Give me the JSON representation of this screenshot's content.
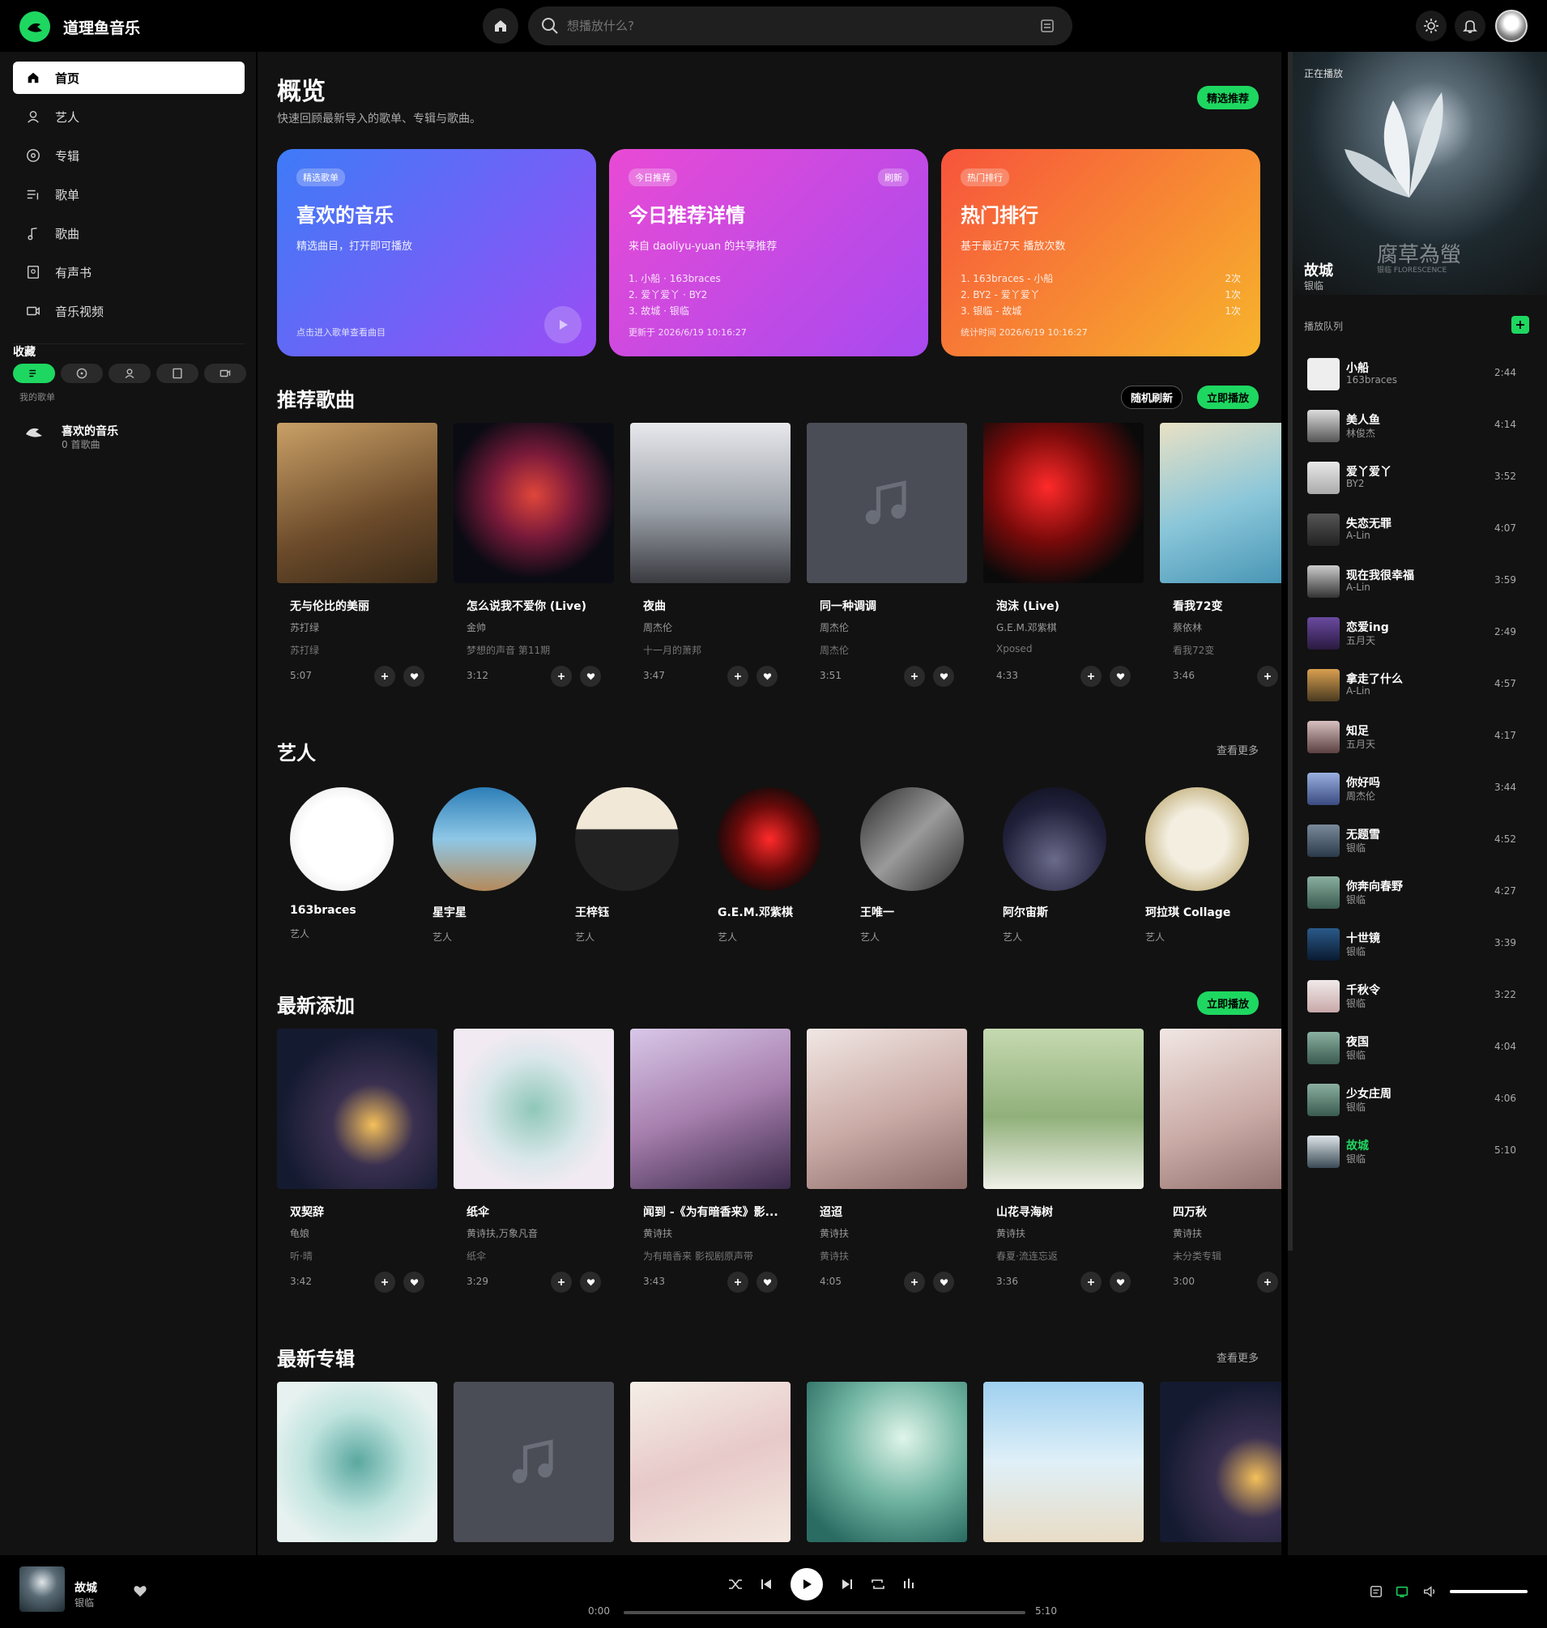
{
  "app": {
    "name": "道理鱼音乐"
  },
  "search": {
    "placeholder": "想播放什么?"
  },
  "sidebar": {
    "items": [
      {
        "label": "首页",
        "icon": "home-icon"
      },
      {
        "label": "艺人",
        "icon": "user-icon"
      },
      {
        "label": "专辑",
        "icon": "disc-icon"
      },
      {
        "label": "歌单",
        "icon": "playlist-icon"
      },
      {
        "label": "歌曲",
        "icon": "music-note-icon"
      },
      {
        "label": "有声书",
        "icon": "book-icon"
      },
      {
        "label": "音乐视频",
        "icon": "video-icon"
      }
    ],
    "favorites_title": "收藏",
    "favorites_tab_label": "我的歌单",
    "playlist": {
      "name": "喜欢的音乐",
      "count": "0 首歌曲"
    }
  },
  "overview": {
    "title": "概览",
    "subtitle": "快速回顾最新导入的歌单、专辑与歌曲。",
    "badge": "精选推荐",
    "cards": [
      {
        "badge": "精选歌单",
        "title": "喜欢的音乐",
        "desc": "精选曲目，打开即可播放",
        "footer": "点击进入歌单查看曲目",
        "color_from": "#3d7bf7",
        "color_to": "#9b4df5"
      },
      {
        "badge": "今日推荐",
        "action": "刷新",
        "title": "今日推荐详情",
        "desc": "来自 daoliyu-yuan 的共享推荐",
        "lines": [
          "1. 小船 · 163braces",
          "2. 爱丫爱丫 · BY2",
          "3. 故城 · 银临"
        ],
        "footer": "更新于 2026/6/19 10:16:27",
        "color_from": "#e94ad4",
        "color_to": "#a74af0"
      },
      {
        "badge": "热门排行",
        "title": "热门排行",
        "desc": "基于最近7天 播放次数",
        "lines": [
          "1. 163braces - 小船",
          "2. BY2 - 爱丫爱丫",
          "3. 银临 - 故城"
        ],
        "counts": [
          "2次",
          "1次",
          "1次"
        ],
        "footer": "统计时间 2026/6/19 10:16:27",
        "color_from": "#f7533c",
        "color_to": "#f7b42c"
      }
    ]
  },
  "recommended": {
    "title": "推荐歌曲",
    "shuffle_label": "随机刷新",
    "play_label": "立即播放",
    "songs": [
      {
        "title": "无与伦比的美丽",
        "artist": "苏打绿",
        "album": "苏打绿",
        "duration": "5:07"
      },
      {
        "title": "怎么说我不爱你 (Live)",
        "artist": "金帅",
        "album": "梦想的声音 第11期",
        "duration": "3:12"
      },
      {
        "title": "夜曲",
        "artist": "周杰伦",
        "album": "十一月的萧邦",
        "duration": "3:47"
      },
      {
        "title": "同一种调调",
        "artist": "周杰伦",
        "album": "周杰伦",
        "duration": "3:51"
      },
      {
        "title": "泡沫 (Live)",
        "artist": "G.E.M.邓紫棋",
        "album": "Xposed",
        "duration": "4:33"
      },
      {
        "title": "看我72变",
        "artist": "蔡依林",
        "album": "看我72变",
        "duration": "3:46"
      }
    ]
  },
  "artists": {
    "title": "艺人",
    "more_label": "查看更多",
    "role": "艺人",
    "items": [
      {
        "name": "163braces"
      },
      {
        "name": "星宇星"
      },
      {
        "name": "王梓钰"
      },
      {
        "name": "G.E.M.邓紫棋"
      },
      {
        "name": "王唯一"
      },
      {
        "name": "阿尔宙斯"
      },
      {
        "name": "珂拉琪 Collage"
      }
    ]
  },
  "latest": {
    "title": "最新添加",
    "play_label": "立即播放",
    "songs": [
      {
        "title": "双契辞",
        "artist": "龟娘",
        "album": "听·晴",
        "duration": "3:42"
      },
      {
        "title": "纸伞",
        "artist": "黄诗扶,万象凡音",
        "album": "纸伞",
        "duration": "3:29"
      },
      {
        "title": "闻到 -《为有暗香来》影...",
        "artist": "黄诗扶",
        "album": "为有暗香来 影视剧原声带",
        "duration": "3:43"
      },
      {
        "title": "迢迢",
        "artist": "黄诗扶",
        "album": "黄诗扶",
        "duration": "4:05"
      },
      {
        "title": "山花寻海树",
        "artist": "黄诗扶",
        "album": "春夏·流连忘返",
        "duration": "3:36"
      },
      {
        "title": "四万秋",
        "artist": "黄诗扶",
        "album": "未分类专辑",
        "duration": "3:00"
      }
    ]
  },
  "albums": {
    "title": "最新专辑",
    "more_label": "查看更多"
  },
  "now_playing": {
    "header": "正在播放",
    "title": "故城",
    "artist": "银临",
    "art_text": "腐草為螢",
    "art_subtext": "银临 FLORESCENCE",
    "queue_title": "播放队列"
  },
  "queue": [
    {
      "title": "小船",
      "artist": "163braces",
      "duration": "2:44"
    },
    {
      "title": "美人鱼",
      "artist": "林俊杰",
      "duration": "4:14"
    },
    {
      "title": "爱丫爱丫",
      "artist": "BY2",
      "duration": "3:52"
    },
    {
      "title": "失恋无罪",
      "artist": "A-Lin",
      "duration": "4:07"
    },
    {
      "title": "现在我很幸福",
      "artist": "A-Lin",
      "duration": "3:59"
    },
    {
      "title": "恋爱ing",
      "artist": "五月天",
      "duration": "2:49"
    },
    {
      "title": "拿走了什么",
      "artist": "A-Lin",
      "duration": "4:57"
    },
    {
      "title": "知足",
      "artist": "五月天",
      "duration": "4:17"
    },
    {
      "title": "你好吗",
      "artist": "周杰伦",
      "duration": "3:44"
    },
    {
      "title": "无题雪",
      "artist": "银临",
      "duration": "4:52"
    },
    {
      "title": "你奔向春野",
      "artist": "银临",
      "duration": "4:27"
    },
    {
      "title": "十世镜",
      "artist": "银临",
      "duration": "3:39"
    },
    {
      "title": "千秋令",
      "artist": "银临",
      "duration": "3:22"
    },
    {
      "title": "夜国",
      "artist": "银临",
      "duration": "4:04"
    },
    {
      "title": "少女庄周",
      "artist": "银临",
      "duration": "4:06"
    },
    {
      "title": "故城",
      "artist": "银临",
      "duration": "5:10",
      "current": true
    }
  ],
  "player": {
    "title": "故城",
    "artist": "银临",
    "current_time": "0:00",
    "total_time": "5:10",
    "progress": 0,
    "volume": 1.0
  },
  "colors": {
    "accent": "#1ed760",
    "panel": "#121212",
    "background": "#000000"
  }
}
